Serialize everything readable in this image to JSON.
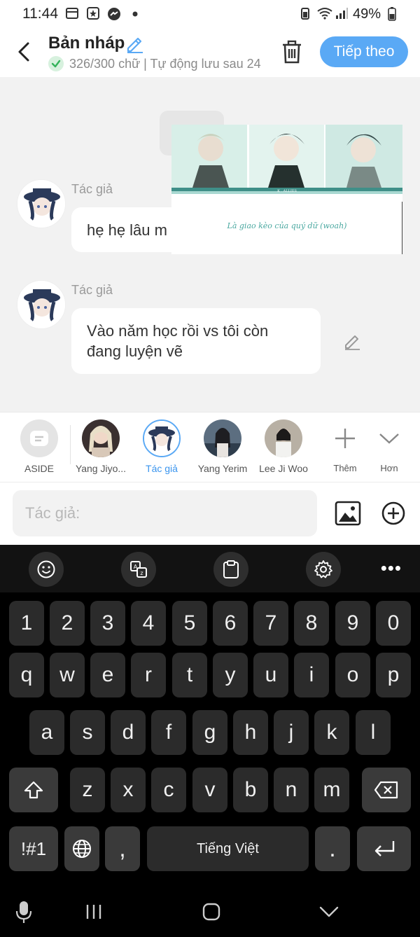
{
  "status_bar": {
    "time": "11:44",
    "battery": "49%"
  },
  "header": {
    "title": "Bản nháp",
    "subtitle": "326/300 chữ | Tự động lưu sau 24",
    "next_label": "Tiếp theo"
  },
  "chat": {
    "messages": [
      {
        "author": "Tác giả",
        "text": "hẹ hẹ lâu m"
      },
      {
        "author": "Tác giả",
        "text": "Vào năm học rồi vs tôi còn đang luyện vẽ"
      }
    ],
    "overlay_caption": "Là giao kèo của quý dữ (woah)"
  },
  "characters": [
    {
      "name": "ASIDE"
    },
    {
      "name": "Yang Jiyo..."
    },
    {
      "name": "Tác giả"
    },
    {
      "name": "Yang Yerim"
    },
    {
      "name": "Lee Ji Woo"
    },
    {
      "name": "Thêm"
    },
    {
      "name": "Hơn"
    }
  ],
  "input": {
    "placeholder": "Tác giả:"
  },
  "keyboard": {
    "row_numbers": [
      "1",
      "2",
      "3",
      "4",
      "5",
      "6",
      "7",
      "8",
      "9",
      "0"
    ],
    "row1": [
      "q",
      "w",
      "e",
      "r",
      "t",
      "y",
      "u",
      "i",
      "o",
      "p"
    ],
    "row2": [
      "a",
      "s",
      "d",
      "f",
      "g",
      "h",
      "j",
      "k",
      "l"
    ],
    "row3": [
      "z",
      "x",
      "c",
      "v",
      "b",
      "n",
      "m"
    ],
    "symbols_label": "!#1",
    "comma": ",",
    "space_label": "Tiếng Việt",
    "period": "."
  },
  "colors": {
    "accent": "#5aa9f5",
    "keyboard_bg": "#000000",
    "key_bg": "#2b2b2b"
  }
}
